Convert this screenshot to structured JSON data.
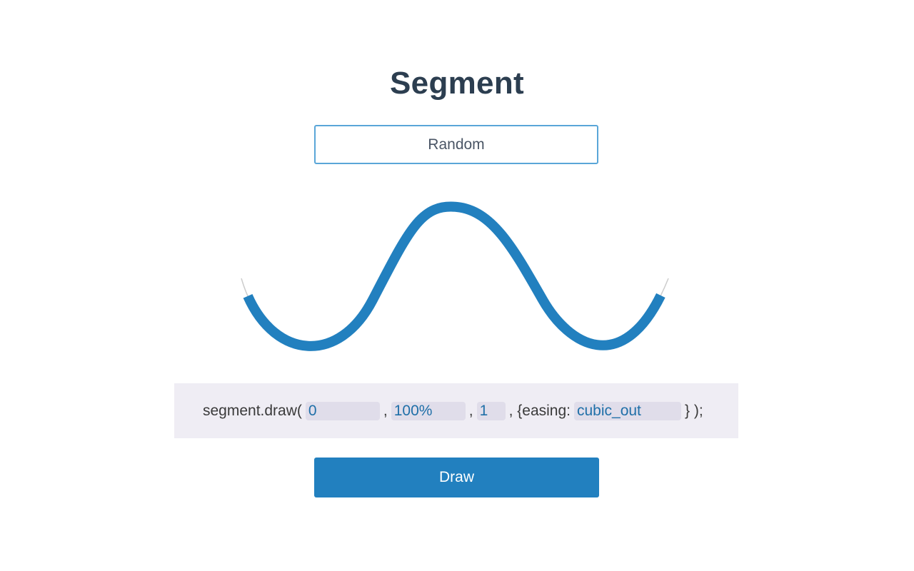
{
  "header": {
    "title": "Segment"
  },
  "preset": {
    "selected": "Random"
  },
  "code": {
    "prefix": "segment.draw(",
    "sep1": ",",
    "sep2": ",",
    "sep3": ", {easing:",
    "suffix": "} );",
    "start_value": "0",
    "end_value": "100%",
    "duration_value": "1",
    "easing_value": "cubic_out"
  },
  "actions": {
    "draw_label": "Draw"
  },
  "colors": {
    "accent": "#2280bf",
    "select_border": "#5aa6d8",
    "code_bg": "#efedf4",
    "guide_path": "#cccccc"
  },
  "segment": {
    "start_fraction": 0.03,
    "end_fraction": 0.97
  }
}
